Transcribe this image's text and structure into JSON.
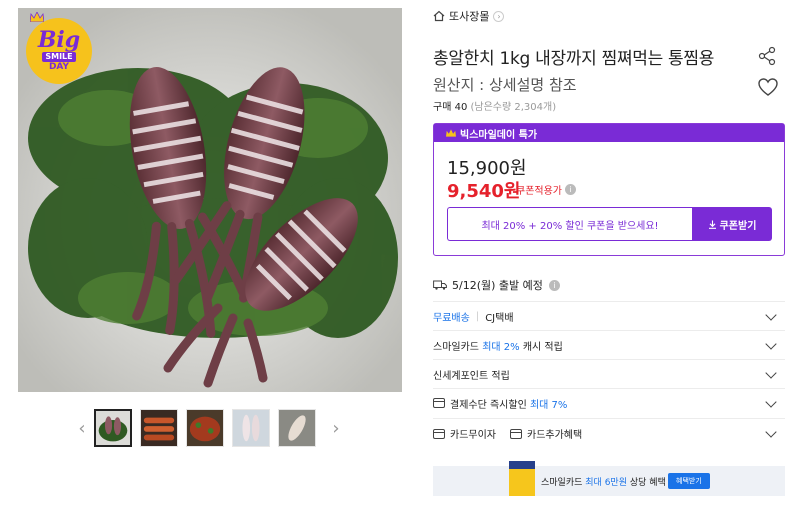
{
  "badge": {
    "line1": "Big",
    "line2": "SMILE",
    "line3": "DAY"
  },
  "gallery": {
    "thumb_count": 5,
    "active_index": 0
  },
  "store": {
    "name": "또사장몰"
  },
  "product": {
    "title": "총알한치 1kg 내장까지 찜쪄먹는 통찜용",
    "origin": "원산지 : 상세설명 참조",
    "purchase_label": "구매 40",
    "purchase_remaining": "(남은수량 2,304개)"
  },
  "deal": {
    "header": "빅스마일데이 특가",
    "original_price": "15,900원",
    "sale_price": "9,540원",
    "coupon_applied": "쿠폰적용가",
    "coupon_text": "최대 20% + 20% 할인 쿠폰을 받으세요!",
    "coupon_button": "쿠폰받기"
  },
  "shipping": {
    "date": "5/12(월) 출발 예정"
  },
  "rows": {
    "delivery_free": "무료배송",
    "delivery_carrier": "CJ택배",
    "smile_card_prefix": "스마일카드",
    "smile_card_rate": "최대 2%",
    "smile_card_suffix": "캐시 적립",
    "shinsegae": "신세계포인트 적립",
    "instant_prefix": "결제수단 즉시할인",
    "instant_rate": "최대 7%",
    "card_interest_free": "카드무이자",
    "card_extra": "카드추가혜택"
  },
  "banner": {
    "prefix": "스마일카드",
    "highlight": "최대 6만원",
    "suffix": "상당 혜택",
    "button": "혜택받기"
  },
  "colors": {
    "accent": "#7a2bd6",
    "sale": "#e5212b",
    "link": "#1a73e8"
  }
}
